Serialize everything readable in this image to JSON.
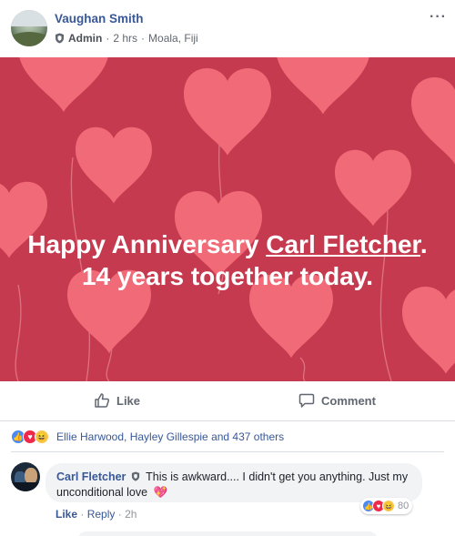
{
  "post": {
    "author": "Vaughan Smith",
    "role": "Admin",
    "time": "2 hrs",
    "location": "Moala, Fiji",
    "more_icon": "···"
  },
  "banner": {
    "line1_prefix": "Happy Anniversary ",
    "tagged_name": "Carl Fletcher",
    "line1_suffix": ".",
    "line2": "14 years together today.",
    "background_color": "#c63a4f",
    "heart_color": "#f06a78"
  },
  "actions": {
    "like_label": "Like",
    "comment_label": "Comment"
  },
  "reactions": {
    "icons": [
      "like-icon",
      "love-icon",
      "haha-icon"
    ],
    "summary": "Ellie Harwood, Hayley Gillespie and 437 others"
  },
  "comment": {
    "author": "Carl Fletcher",
    "text": "This is awkward.... I didn't get you anything. Just my unconditional love",
    "emoji": "💖",
    "reaction_count": "80",
    "like_label": "Like",
    "reply_label": "Reply",
    "time": "2h"
  }
}
